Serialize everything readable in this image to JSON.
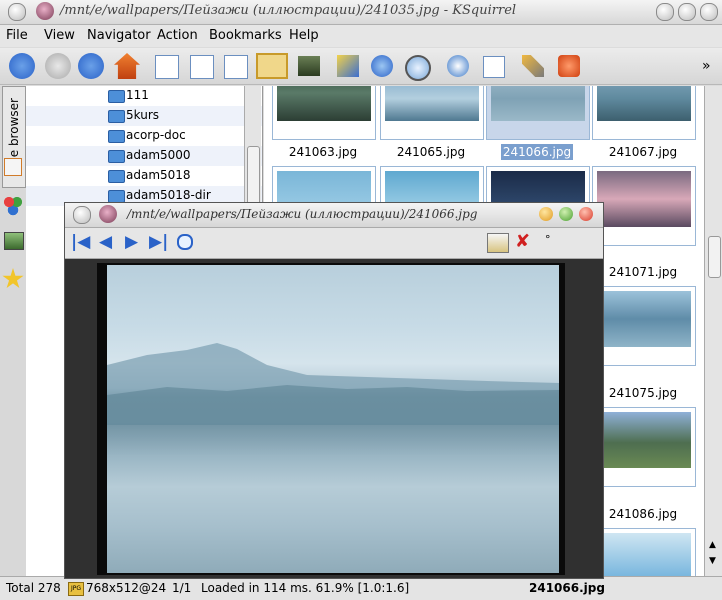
{
  "window": {
    "title": "/mnt/e/wallpapers/Пейзажи (иллюстрации)/241035.jpg - KSquirrel"
  },
  "menu": [
    {
      "label": "File"
    },
    {
      "label": "View"
    },
    {
      "label": "Navigator"
    },
    {
      "label": "Action"
    },
    {
      "label": "Bookmarks"
    },
    {
      "label": "Help"
    }
  ],
  "toolbar": {
    "icons": [
      "back-icon",
      "forward-icon",
      "up-icon",
      "home-icon",
      "view-icons-icon",
      "view-list-icon",
      "view-details-icon",
      "view-thumbnails-icon",
      "slideshow-icon",
      "copy-icon",
      "settings-icon",
      "zoom-icon",
      "speedometer-icon",
      "filter-icon",
      "tools-icon",
      "quit-icon"
    ],
    "overflow": "»"
  },
  "sidebar": {
    "tab_label": "File browser"
  },
  "tree": {
    "items": [
      {
        "label": "111"
      },
      {
        "label": "5kurs"
      },
      {
        "label": "acorp-doc"
      },
      {
        "label": "adam5000"
      },
      {
        "label": "adam5018"
      },
      {
        "label": "adam5018-dir"
      }
    ]
  },
  "thumbnails": {
    "row1": [
      {
        "label": "241063.jpg"
      },
      {
        "label": "241065.jpg"
      },
      {
        "label": "241066.jpg",
        "selected": true
      },
      {
        "label": "241067.jpg"
      }
    ],
    "right_column": [
      {
        "label": "241071.jpg"
      },
      {
        "label": "241075.jpg"
      },
      {
        "label": "241086.jpg"
      }
    ]
  },
  "viewer": {
    "title": "/mnt/e/wallpapers/Пейзажи (иллюстрации)/241066.jpg",
    "toolbar_icons": [
      "first-icon",
      "prev-icon",
      "next-icon",
      "last-icon",
      "zoom-in-icon",
      "properties-icon",
      "close-red-icon"
    ],
    "toolbar_extra": "°"
  },
  "status": {
    "total": "Total 278",
    "dims": "768x512@24",
    "page": "1/1",
    "loaded": "Loaded in 114 ms. 61.9% [1.0:1.6]",
    "filename": "241066.jpg"
  },
  "colors": {
    "accent": "#2a62c8",
    "selection": "#7a9fce",
    "folder": "#4d8fd8"
  }
}
